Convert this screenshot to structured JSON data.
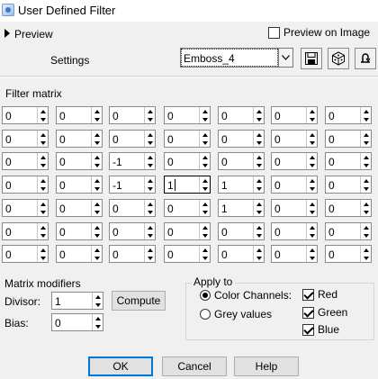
{
  "window": {
    "title": "User Defined Filter"
  },
  "preview": {
    "label": "Preview",
    "preview_on_image_label": "Preview on Image",
    "preview_on_image_checked": false
  },
  "settings": {
    "label": "Settings",
    "preset_value": "Emboss_4"
  },
  "matrix": {
    "label": "Filter matrix",
    "rows": [
      [
        "0",
        "0",
        "0",
        "0",
        "0",
        "0",
        "0"
      ],
      [
        "0",
        "0",
        "0",
        "0",
        "0",
        "0",
        "0"
      ],
      [
        "0",
        "0",
        "-1",
        "0",
        "0",
        "0",
        "0"
      ],
      [
        "0",
        "0",
        "-1",
        "1",
        "1",
        "0",
        "0"
      ],
      [
        "0",
        "0",
        "0",
        "0",
        "1",
        "0",
        "0"
      ],
      [
        "0",
        "0",
        "0",
        "0",
        "0",
        "0",
        "0"
      ],
      [
        "0",
        "0",
        "0",
        "0",
        "0",
        "0",
        "0"
      ]
    ]
  },
  "modifiers": {
    "title": "Matrix modifiers",
    "divisor_label": "Divisor:",
    "divisor_value": "1",
    "bias_label": "Bias:",
    "bias_value": "0",
    "compute_label": "Compute"
  },
  "apply_to": {
    "title": "Apply to",
    "color_channels_label": "Color Channels:",
    "grey_values_label": "Grey values",
    "selected": "color_channels",
    "channels": [
      {
        "label": "Red",
        "checked": true
      },
      {
        "label": "Green",
        "checked": true
      },
      {
        "label": "Blue",
        "checked": true
      }
    ]
  },
  "buttons": {
    "ok": "OK",
    "cancel": "Cancel",
    "help": "Help"
  }
}
